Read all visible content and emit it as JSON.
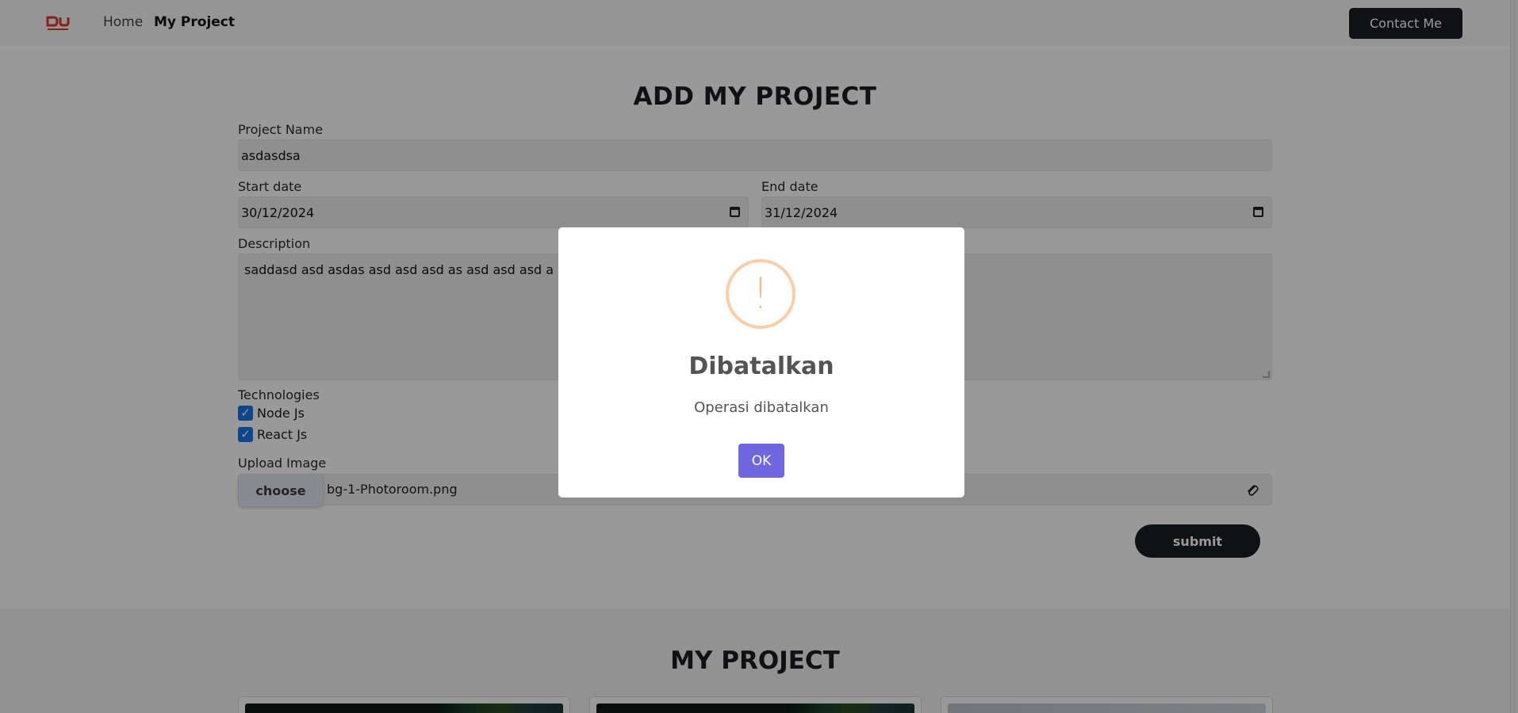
{
  "navbar": {
    "logo_text": "DU",
    "home_label": "Home",
    "project_label": "My Project",
    "contact_label": "Contact Me"
  },
  "form": {
    "title": "ADD MY PROJECT",
    "project_name_label": "Project Name",
    "project_name_value": "asdasdsa",
    "start_date_label": "Start date",
    "start_date_value": "30/12/2024",
    "end_date_label": "End date",
    "end_date_value": "31/12/2024",
    "description_label": "Description",
    "description_value": "saddasd asd asdas asd asd asd as asd asd asd a",
    "technologies_label": "Technologies",
    "technologies": [
      {
        "label": "Node Js",
        "checked": true
      },
      {
        "label": "React Js",
        "checked": true
      }
    ],
    "upload_label": "Upload Image",
    "choose_label": "choose",
    "file_name": "bg-1-Photoroom.png",
    "submit_label": "submit"
  },
  "projects": {
    "title": "MY PROJECT"
  },
  "modal": {
    "icon_glyph": "!",
    "title": "Dibatalkan",
    "text": "Operasi dibatalkan",
    "ok_label": "OK"
  },
  "colors": {
    "dark": "#1c1d22",
    "modal_button": "#7066e0",
    "warning_icon": "#f8bb86",
    "checkbox": "#1a73e8",
    "logo": "#e0392b"
  }
}
